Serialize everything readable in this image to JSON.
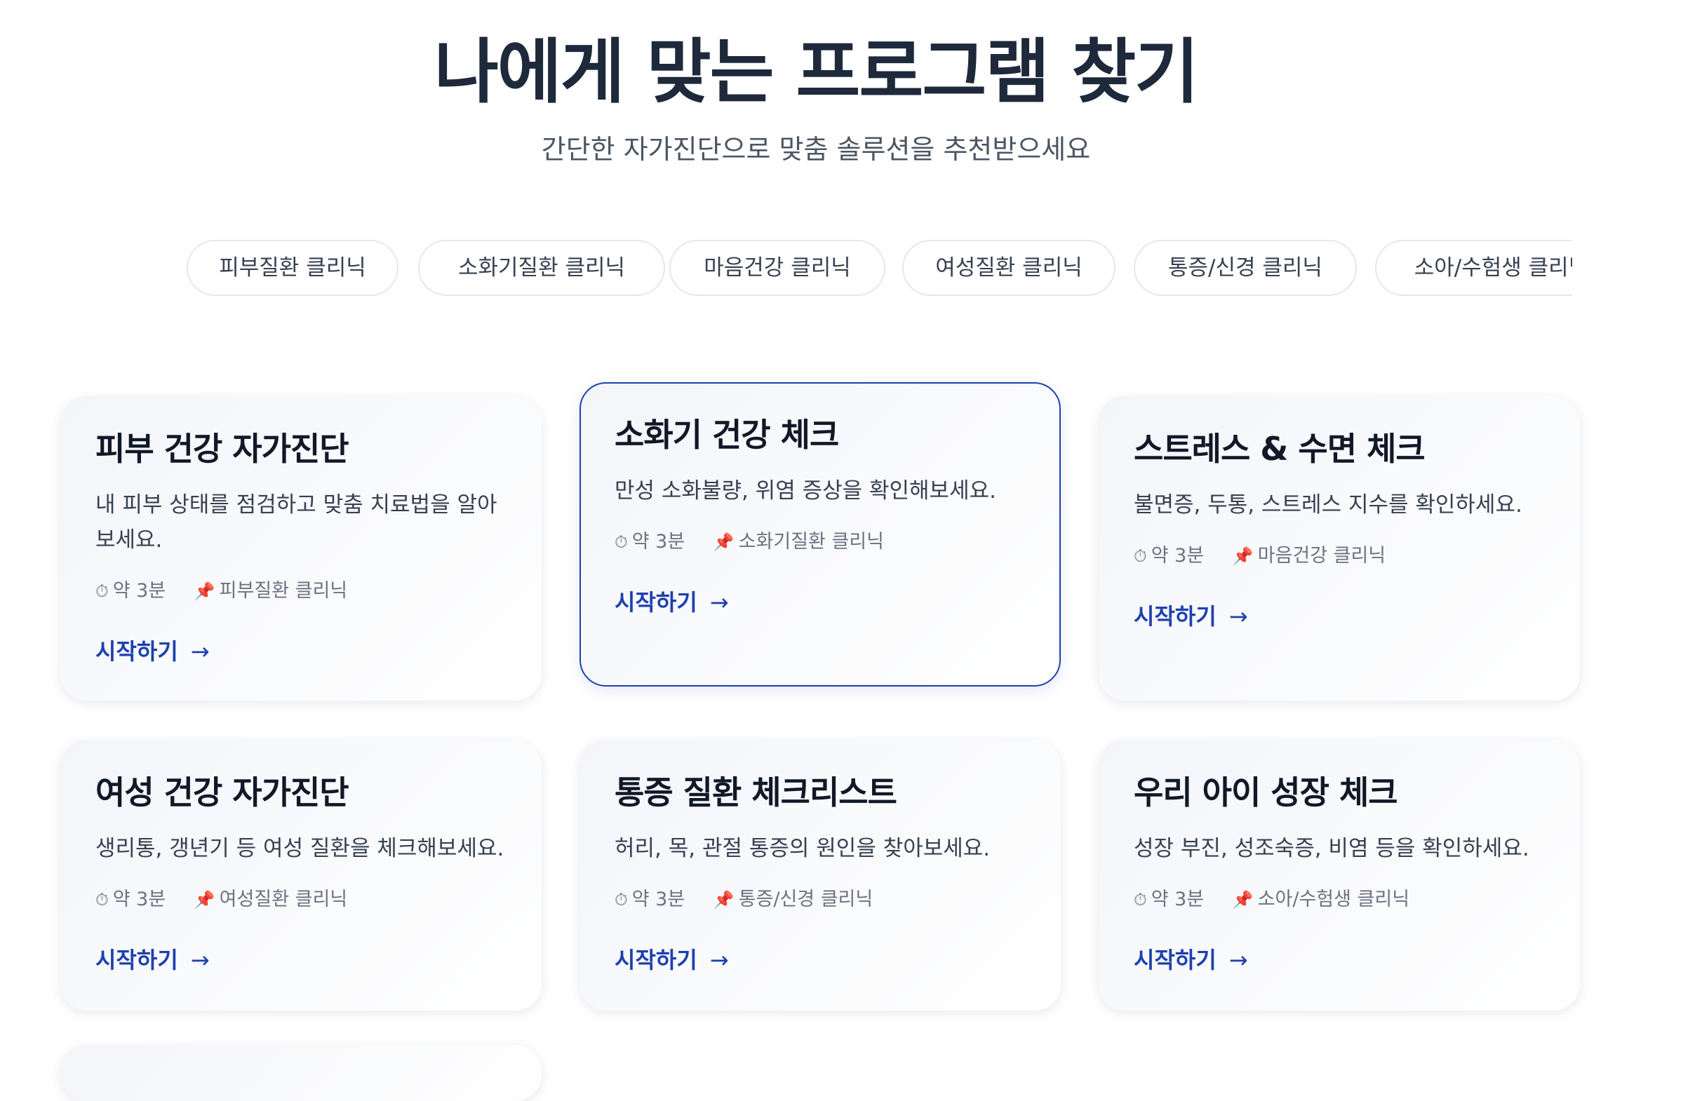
{
  "header": {
    "title": "나에게 맞는 프로그램 찾기",
    "subtitle": "간단한 자가진단으로 맞춤 솔루션을 추천받으세요"
  },
  "tabs": [
    {
      "label": "피부질환 클리닉"
    },
    {
      "label": "소화기질환 클리닉"
    },
    {
      "label": "마음건강 클리닉"
    },
    {
      "label": "여성질환 클리닉"
    },
    {
      "label": "통증/신경 클리닉"
    },
    {
      "label": "소아/수험생 클리닉"
    }
  ],
  "cards": [
    {
      "title": "피부 건강 자가진단",
      "description": "내 피부 상태를 점검하고 맞춤 치료법을 알아보세요.",
      "duration": "약 3분",
      "clinic": "피부질환 클리닉",
      "cta": "시작하기",
      "arrow": "→"
    },
    {
      "title": "소화기 건강 체크",
      "description": "만성 소화불량, 위염 증상을 확인해보세요.",
      "duration": "약 3분",
      "clinic": "소화기질환 클리닉",
      "cta": "시작하기",
      "arrow": "→"
    },
    {
      "title": "스트레스 & 수면 체크",
      "description": "불면증, 두통, 스트레스 지수를 확인하세요.",
      "duration": "약 3분",
      "clinic": "마음건강 클리닉",
      "cta": "시작하기",
      "arrow": "→"
    },
    {
      "title": "여성 건강 자가진단",
      "description": "생리통, 갱년기 등 여성 질환을 체크해보세요.",
      "duration": "약 3분",
      "clinic": "여성질환 클리닉",
      "cta": "시작하기",
      "arrow": "→"
    },
    {
      "title": "통증 질환 체크리스트",
      "description": "허리, 목, 관절 통증의 원인을 찾아보세요.",
      "duration": "약 3분",
      "clinic": "통증/신경 클리닉",
      "cta": "시작하기",
      "arrow": "→"
    },
    {
      "title": "우리 아이 성장 체크",
      "description": "성장 부진, 성조숙증, 비염 등을 확인하세요.",
      "duration": "약 3분",
      "clinic": "소아/수험생 클리닉",
      "cta": "시작하기",
      "arrow": "→"
    }
  ],
  "icons": {
    "duration": "⏱",
    "clinic": "📌"
  },
  "colors": {
    "accent": "#1e40af",
    "title": "#1e293b",
    "pin": "#dc2626"
  }
}
